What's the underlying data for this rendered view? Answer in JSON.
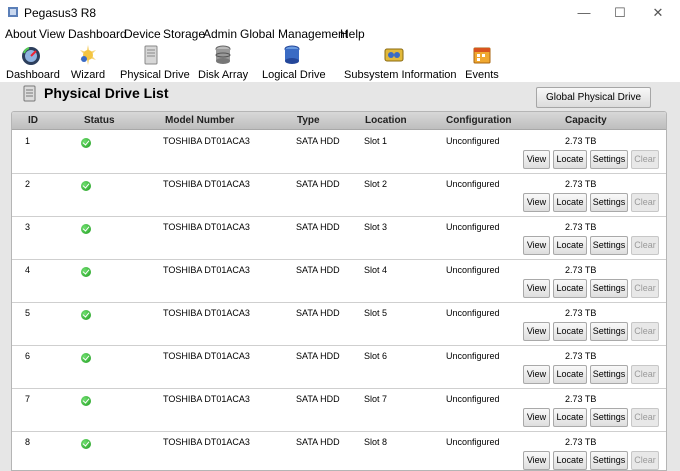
{
  "window": {
    "title": "Pegasus3 R8"
  },
  "menu": [
    "About",
    "View",
    "Dashboard",
    "Device",
    "Storage",
    "Admin",
    "Global Management",
    "Help"
  ],
  "toolbar": [
    {
      "label": "Dashboard",
      "icon": "dashboard-icon"
    },
    {
      "label": "Wizard",
      "icon": "wizard-icon"
    },
    {
      "label": "Physical Drive",
      "icon": "physical-drive-icon"
    },
    {
      "label": "Disk Array",
      "icon": "disk-array-icon"
    },
    {
      "label": "Logical Drive",
      "icon": "logical-drive-icon"
    },
    {
      "label": "Subsystem Information",
      "icon": "subsystem-info-icon"
    },
    {
      "label": "Events",
      "icon": "events-icon"
    }
  ],
  "page": {
    "title": "Physical Drive List",
    "global_settings_label": "Global Physical Drive Settings"
  },
  "table": {
    "headers": [
      "ID",
      "Status",
      "Model Number",
      "Type",
      "Location",
      "Configuration",
      "Capacity"
    ],
    "actions": {
      "view": "View",
      "locate": "Locate",
      "settings": "Settings",
      "clear": "Clear"
    },
    "rows": [
      {
        "id": "1",
        "status": "ok",
        "model": "TOSHIBA DT01ACA3",
        "type": "SATA HDD",
        "location": "Slot 1",
        "configuration": "Unconfigured",
        "capacity": "2.73 TB"
      },
      {
        "id": "2",
        "status": "ok",
        "model": "TOSHIBA DT01ACA3",
        "type": "SATA HDD",
        "location": "Slot 2",
        "configuration": "Unconfigured",
        "capacity": "2.73 TB"
      },
      {
        "id": "3",
        "status": "ok",
        "model": "TOSHIBA DT01ACA3",
        "type": "SATA HDD",
        "location": "Slot 3",
        "configuration": "Unconfigured",
        "capacity": "2.73 TB"
      },
      {
        "id": "4",
        "status": "ok",
        "model": "TOSHIBA DT01ACA3",
        "type": "SATA HDD",
        "location": "Slot 4",
        "configuration": "Unconfigured",
        "capacity": "2.73 TB"
      },
      {
        "id": "5",
        "status": "ok",
        "model": "TOSHIBA DT01ACA3",
        "type": "SATA HDD",
        "location": "Slot 5",
        "configuration": "Unconfigured",
        "capacity": "2.73 TB"
      },
      {
        "id": "6",
        "status": "ok",
        "model": "TOSHIBA DT01ACA3",
        "type": "SATA HDD",
        "location": "Slot 6",
        "configuration": "Unconfigured",
        "capacity": "2.73 TB"
      },
      {
        "id": "7",
        "status": "ok",
        "model": "TOSHIBA DT01ACA3",
        "type": "SATA HDD",
        "location": "Slot 7",
        "configuration": "Unconfigured",
        "capacity": "2.73 TB"
      },
      {
        "id": "8",
        "status": "ok",
        "model": "TOSHIBA DT01ACA3",
        "type": "SATA HDD",
        "location": "Slot 8",
        "configuration": "Unconfigured",
        "capacity": "2.73 TB"
      }
    ]
  },
  "colors": {
    "status_ok": "#2aa52a",
    "panel_bg": "#e6e6e6",
    "header_bg": "#cbcbcb"
  }
}
